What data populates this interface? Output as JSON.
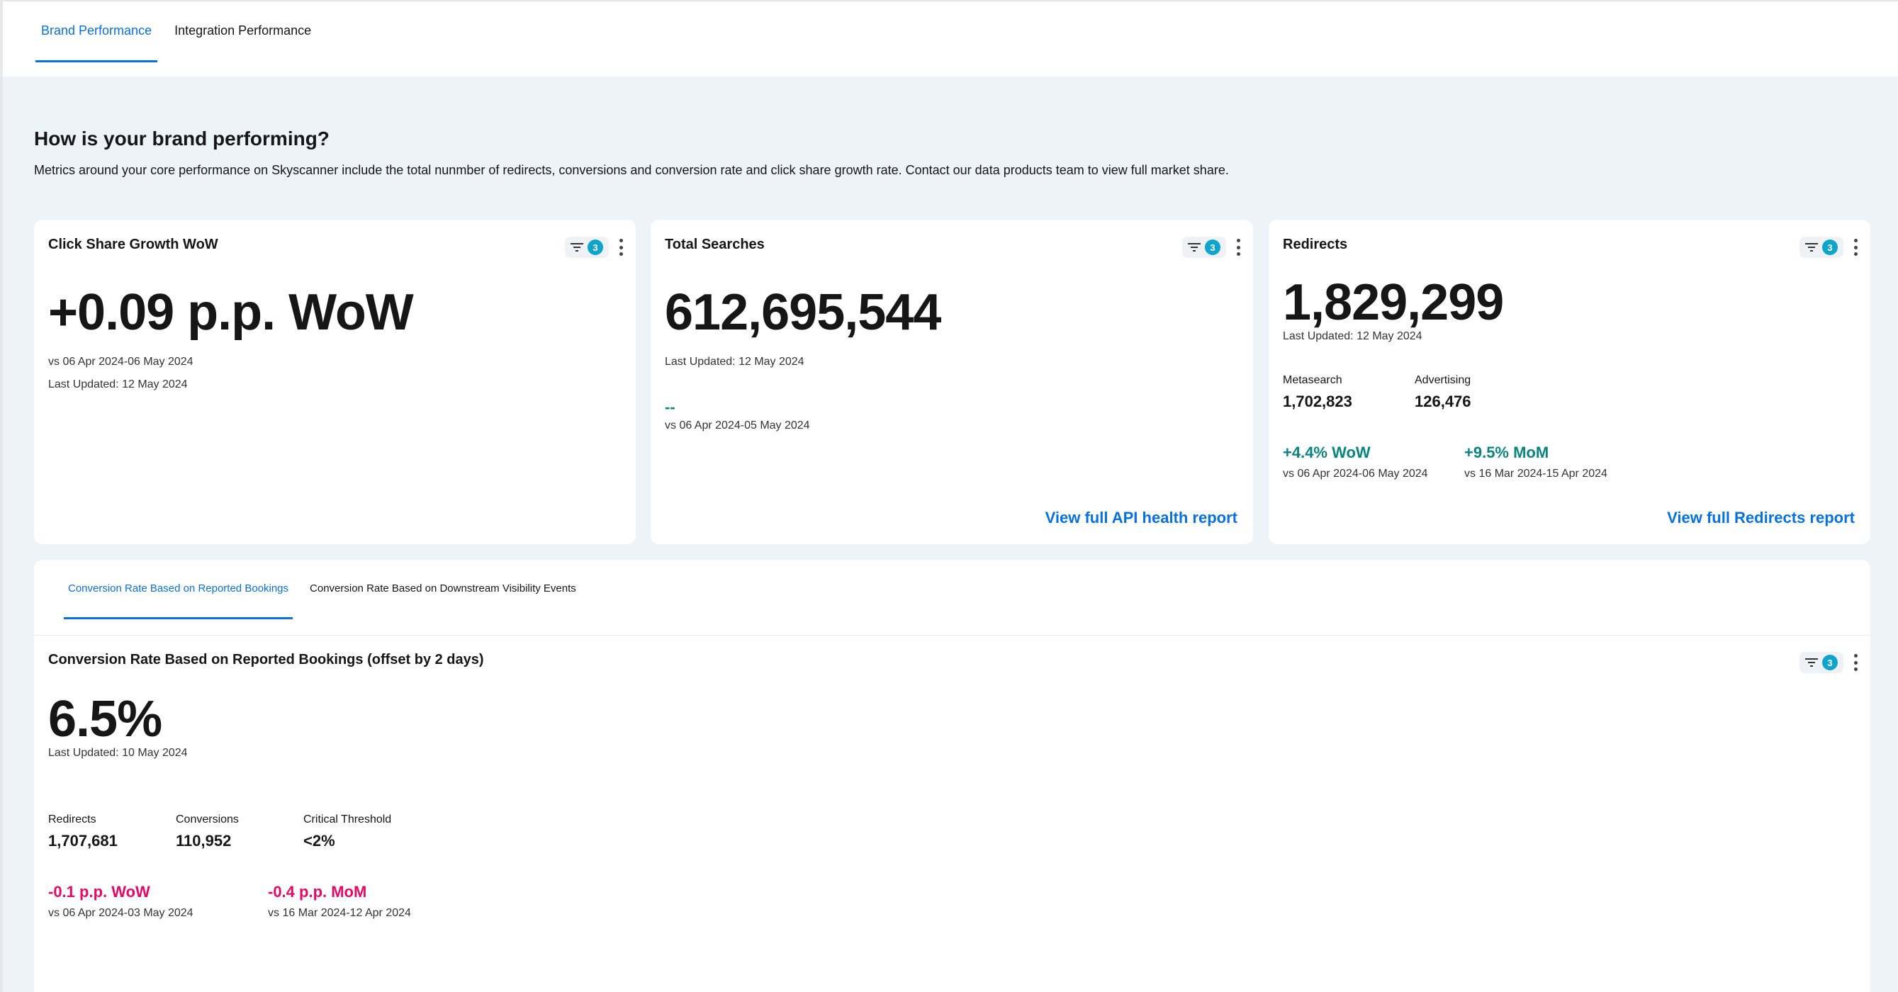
{
  "top_tabs": [
    {
      "label": "Brand Performance"
    },
    {
      "label": "Integration Performance"
    }
  ],
  "intro": {
    "title": "How is your brand performing?",
    "description": "Metrics around your core performance on Skyscanner include the total nunmber of redirects, conversions and conversion rate and click share growth rate. Contact our data products team to view full market share."
  },
  "filter_count": "3",
  "click_share": {
    "title": "Click Share Growth WoW",
    "value": "+0.09 p.p. WoW",
    "comparison": "vs 06 Apr 2024-06 May 2024",
    "updated": "Last Updated: 12 May 2024"
  },
  "total_searches": {
    "title": "Total Searches",
    "value": "612,695,544",
    "updated": "Last Updated: 12 May 2024",
    "change": "--",
    "comparison": "vs 06 Apr 2024-05 May 2024",
    "link": "View full API health report"
  },
  "redirects": {
    "title": "Redirects",
    "value": "1,829,299",
    "updated": "Last Updated: 12 May 2024",
    "metasearch_label": "Metasearch",
    "metasearch_value": "1,702,823",
    "advertising_label": "Advertising",
    "advertising_value": "126,476",
    "wow": "+4.4% WoW",
    "wow_period": "vs 06 Apr 2024-06 May 2024",
    "mom": "+9.5% MoM",
    "mom_period": "vs 16 Mar 2024-15 Apr 2024",
    "link": "View full Redirects report"
  },
  "conversion_tabs": [
    {
      "label": "Conversion Rate Based on Reported Bookings"
    },
    {
      "label": "Conversion Rate Based on Downstream Visibility Events"
    }
  ],
  "conversion": {
    "title": "Conversion Rate Based on Reported Bookings (offset by 2 days)",
    "value": "6.5%",
    "updated": "Last Updated: 10 May 2024",
    "redirects_label": "Redirects",
    "redirects_value": "1,707,681",
    "conversions_label": "Conversions",
    "conversions_value": "110,952",
    "threshold_label": "Critical Threshold",
    "threshold_value": "<2%",
    "wow": "-0.1 p.p. WoW",
    "wow_period": "vs 06 Apr 2024-03 May 2024",
    "mom": "-0.4 p.p. MoM",
    "mom_period": "vs 16 Mar 2024-12 Apr 2024"
  },
  "colors": {
    "accent": "#0770e3",
    "positive": "#0a8480",
    "negative": "#e70866",
    "badge": "#0fa4c9",
    "background": "#eef2f9"
  },
  "icons": [
    "filter-icon",
    "kebab-menu-icon"
  ]
}
